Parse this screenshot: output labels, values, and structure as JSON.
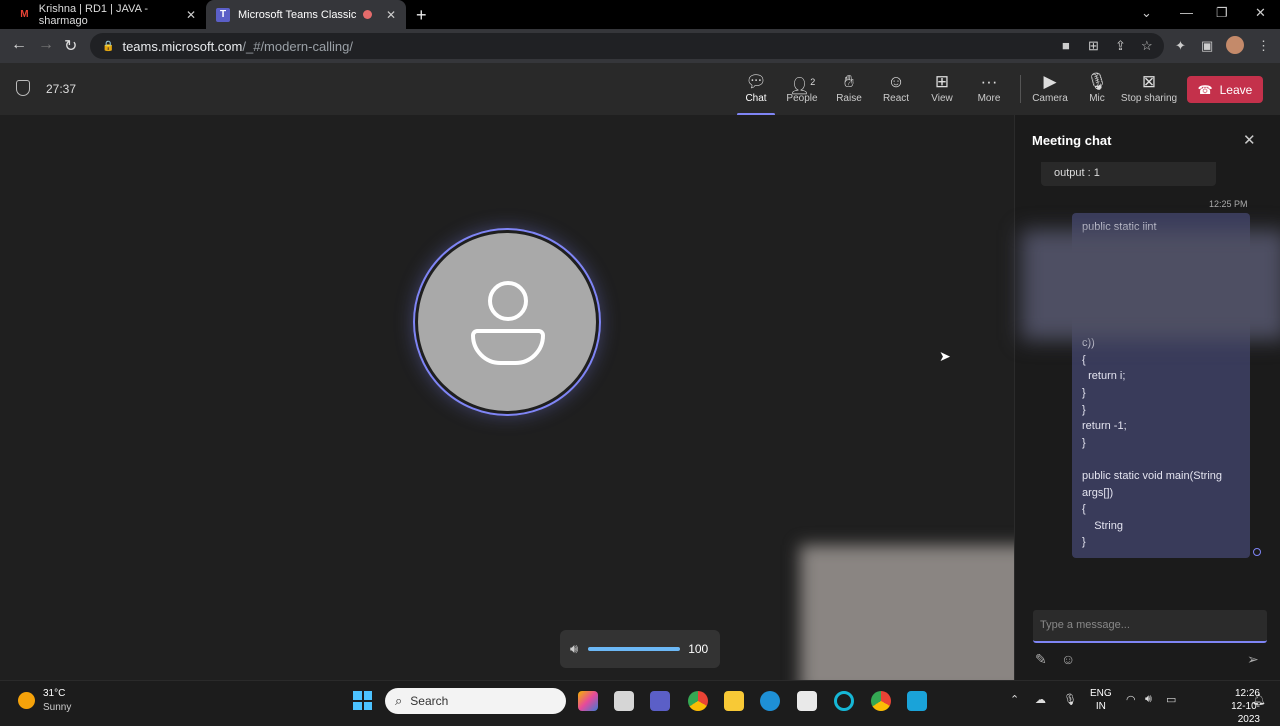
{
  "browser": {
    "tabs": [
      {
        "title": "Krishna | RD1 | JAVA - sharmago",
        "icon": "gmail-icon"
      },
      {
        "title": "Microsoft Teams Classic",
        "icon": "teams-icon",
        "recording": true
      }
    ],
    "url_host": "teams.microsoft.com",
    "url_path": "/_#/modern-calling/"
  },
  "meeting": {
    "timer": "27:37",
    "toolbar": {
      "chat": "Chat",
      "people": "People",
      "people_count": "2",
      "raise": "Raise",
      "react": "React",
      "view": "View",
      "more": "More",
      "camera": "Camera",
      "mic": "Mic",
      "stop_sharing": "Stop sharing",
      "leave": "Leave"
    },
    "volume": "100"
  },
  "chat": {
    "title": "Meeting chat",
    "prev_message": "output : 1",
    "timestamp": "12:25 PM",
    "message_lines": [
      "public static iint",
      "",
      "",
      "",
      "",
      "",
      "",
      "c))",
      "{",
      "  return i;",
      "}",
      "}",
      "return -1;",
      "}",
      "",
      "public static void main(String",
      "args[])",
      "{",
      "    String",
      "}"
    ],
    "compose_placeholder": "Type a message..."
  },
  "taskbar": {
    "temperature": "31°C",
    "condition": "Sunny",
    "search_placeholder": "Search",
    "lang_1": "ENG",
    "lang_2": "IN",
    "time": "12:26",
    "date": "12-10-2023"
  },
  "colors": {
    "accent": "#7f85f5",
    "leave": "#c4314b",
    "message_bg": "#393b5a"
  }
}
